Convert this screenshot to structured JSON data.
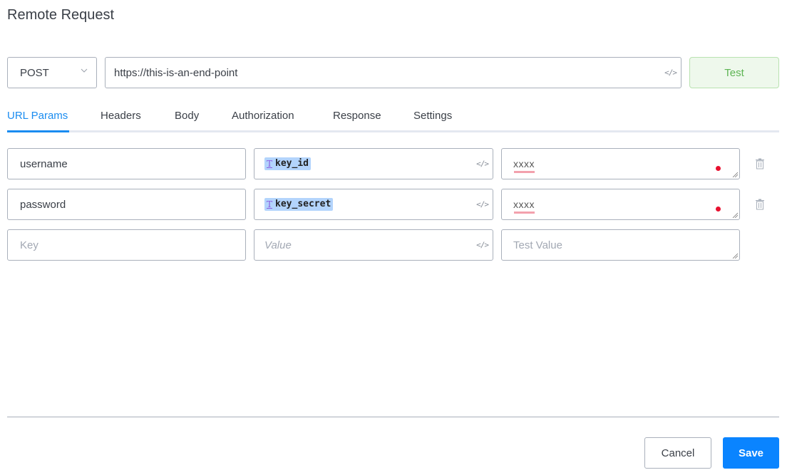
{
  "title": "Remote Request",
  "request": {
    "method": "POST",
    "url": "https://this-is-an-end-point",
    "test_label": "Test"
  },
  "tabs": [
    {
      "label": "URL Params",
      "active": true
    },
    {
      "label": "Headers"
    },
    {
      "label": "Body"
    },
    {
      "label": "Authorization"
    },
    {
      "label": "Response"
    },
    {
      "label": "Settings"
    }
  ],
  "params": [
    {
      "key": "username",
      "value_token": "key_id",
      "test_value": "xxxx"
    },
    {
      "key": "password",
      "value_token": "key_secret",
      "test_value": "xxxx"
    }
  ],
  "new_param": {
    "key_placeholder": "Key",
    "value_placeholder": "Value",
    "test_placeholder": "Test Value"
  },
  "icons": {
    "code": "</>",
    "token": "T"
  },
  "footer": {
    "cancel_label": "Cancel",
    "save_label": "Save"
  },
  "colors": {
    "accent": "#1a8cf0",
    "save": "#0a84ff",
    "test_text": "#5db453",
    "error_dot": "#e8102f"
  }
}
